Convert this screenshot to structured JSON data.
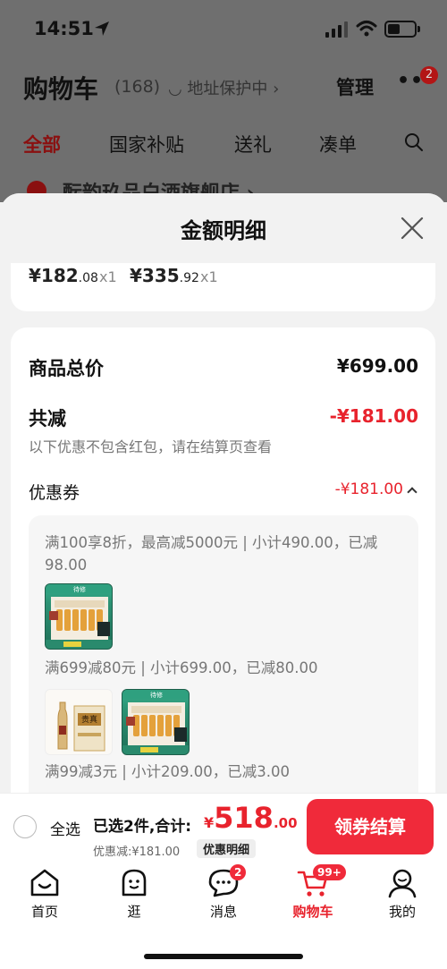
{
  "status_bar": {
    "time": "14:51"
  },
  "background_page": {
    "title": "购物车",
    "count": "(168)",
    "address": "◡ 地址保护中 ›",
    "manage": "管理",
    "more_badge": "2",
    "tabs": [
      "全部",
      "国家补贴",
      "送礼",
      "凑单"
    ],
    "store_name": "酝韵玖品白酒旗舰店 ›"
  },
  "sheet": {
    "title": "金额明细",
    "prices": [
      {
        "int": "¥182",
        "dec": ".08",
        "qty": "x1"
      },
      {
        "int": "¥335",
        "dec": ".92",
        "qty": "x1"
      }
    ],
    "total_label": "商品总价",
    "total_value": "¥699.00",
    "reduce_label": "共减",
    "reduce_value": "-¥181.00",
    "note": "以下优惠不包含红包，请在结算页查看",
    "coupon_label": "优惠券",
    "coupon_value": "-¥181.00",
    "rules": [
      "满100享8折，最高减5000元 | 小计490.00，已减98.00",
      "满699减80元 | 小计699.00，已减80.00",
      "满99减3元 | 小计209.00，已减3.00"
    ],
    "product_tag": "待修",
    "product_name": "贵真"
  },
  "checkout": {
    "select_all": "全选",
    "selected": "已选2件,合计:",
    "currency": "¥",
    "amount_int": "518",
    "amount_dec": ".00",
    "discount": "优惠减:¥181.00",
    "detail_button": "优惠明细",
    "pay_button": "领券结算"
  },
  "tabbar": {
    "items": [
      {
        "label": "首页"
      },
      {
        "label": "逛"
      },
      {
        "label": "消息",
        "badge": "2"
      },
      {
        "label": "购物车",
        "badge": "99+"
      },
      {
        "label": "我的"
      }
    ]
  },
  "colors": {
    "accent": "#e8232d",
    "button": "#f02a3a",
    "sheet_bg": "#f2f2f2",
    "overlay": "#6f6f6f"
  }
}
